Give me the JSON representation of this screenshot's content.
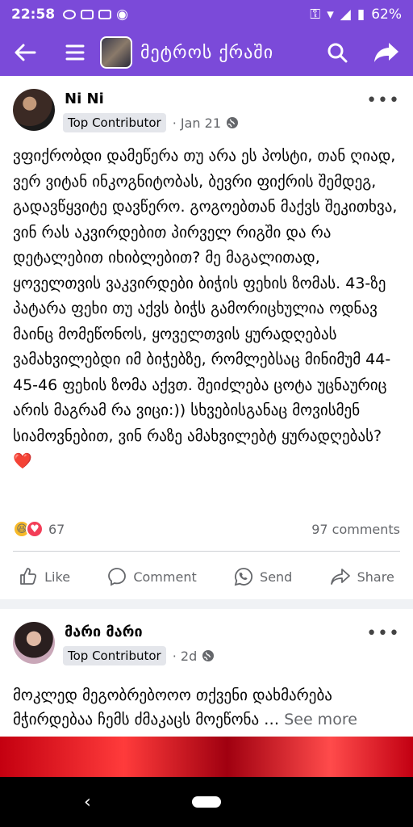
{
  "status": {
    "time": "22:58",
    "battery": "62%"
  },
  "toolbar": {
    "title": "მეტროს ქრაში"
  },
  "posts": [
    {
      "author": "Ni Ni",
      "badge": "Top Contributor",
      "date": "Jan 21",
      "body": "ვფიქრობდი დამეწერა თუ არა ეს პოსტი, თან ღიად, ვერ ვიტან ინკოგნიტობას, ბევრი ფიქრის შემდეგ, გადავწყვიტე დავწერო. გოგოებთან მაქვს შეკითხვა, ვინ რას აკვირდებით პირველ რიგში და რა დეტალებით იხიბლებით? მე მაგალითად, ყოველთვის ვაკვირდები ბიჭის ფეხის ზომას. 43-ზე პატარა ფეხი თუ აქვს ბიჭს გამორიცხულია ოდნავ მაინც მომეწონოს, ყოველთვის ყურადღებას ვამახვილებდი იმ ბიჭებზე, რომლებსაც მინიმუმ 44-45-46 ფეხის ზომა აქვთ. შეიძლება ცოტა უცნაურიც არის მაგრამ რა ვიცი:)) სხვებისგანაც მოვისმენ სიამოვნებით, ვინ რაზე ამახვილებტ ყურადღებას? ❤️",
      "reaction_count": "67",
      "comments": "97 comments"
    },
    {
      "author": "მარი მარი",
      "badge": "Top Contributor",
      "date": "2d",
      "body": "მოკლედ მეგობრებოოო თქვენი დახმარება მჭირდებაა ჩემს ძმაკაცს მოეწონა … ",
      "see_more": "See more"
    }
  ],
  "actions": {
    "like": "Like",
    "comment": "Comment",
    "send": "Send",
    "share": "Share"
  }
}
